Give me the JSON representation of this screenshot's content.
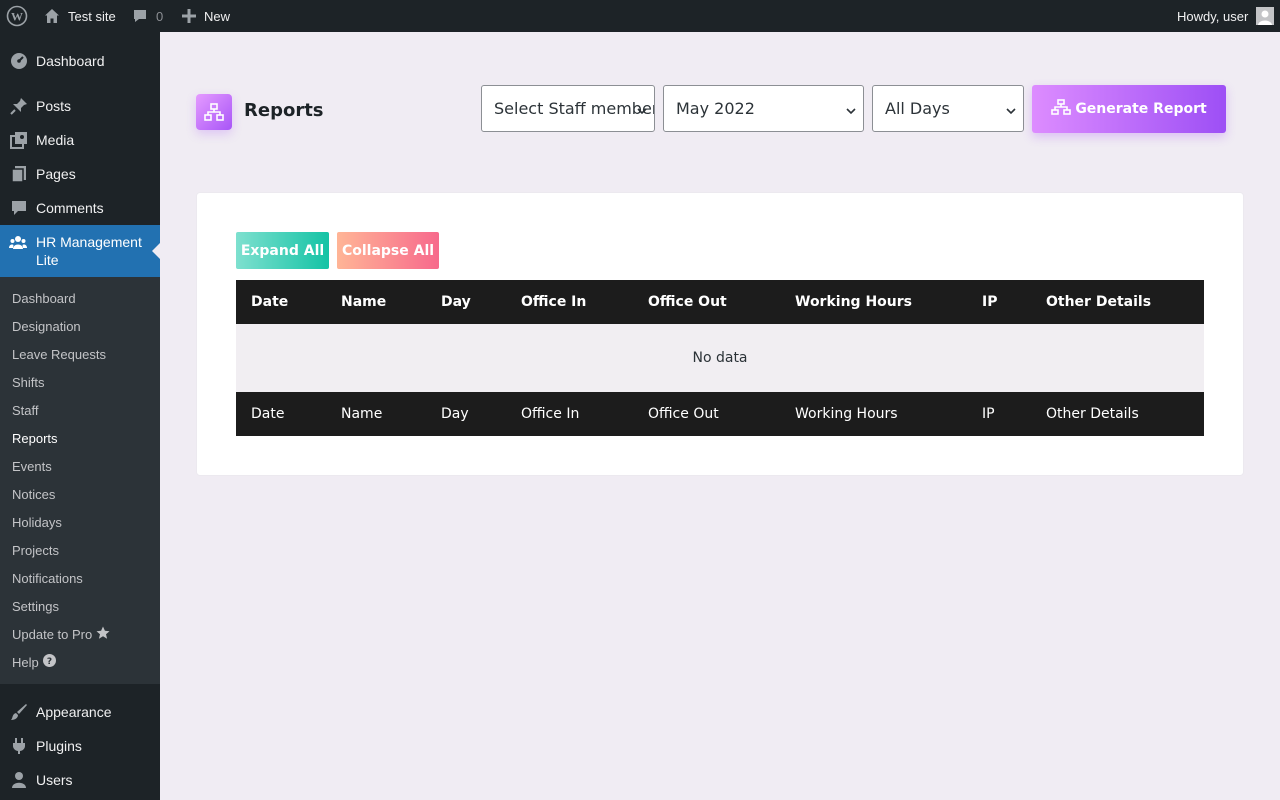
{
  "adminbar": {
    "site_name": "Test site",
    "comments_count": "0",
    "new_label": "New",
    "greeting": "Howdy, user"
  },
  "sidebar": {
    "items_top": [
      {
        "label": "Dashboard",
        "icon": "dashboard-icon"
      },
      {
        "label": "Posts",
        "icon": "pin-icon"
      },
      {
        "label": "Media",
        "icon": "media-icon"
      },
      {
        "label": "Pages",
        "icon": "pages-icon"
      },
      {
        "label": "Comments",
        "icon": "comment-icon"
      }
    ],
    "active": {
      "label_line1": "HR Management",
      "label_line2": "Lite",
      "icon": "users-group-icon"
    },
    "submenu": [
      "Dashboard",
      "Designation",
      "Leave Requests",
      "Shifts",
      "Staff",
      "Reports",
      "Events",
      "Notices",
      "Holidays",
      "Projects",
      "Notifications",
      "Settings",
      "Update to Pro",
      "Help"
    ],
    "submenu_current": "Reports",
    "items_bottom": [
      {
        "label": "Appearance",
        "icon": "brush-icon"
      },
      {
        "label": "Plugins",
        "icon": "plugin-icon"
      },
      {
        "label": "Users",
        "icon": "user-icon"
      }
    ]
  },
  "main": {
    "title": "Reports",
    "filters": {
      "staff": "Select Staff member",
      "month": "May 2022",
      "days": "All Days"
    },
    "generate_label": "Generate Report",
    "expand_label": "Expand All",
    "collapse_label": "Collapse All",
    "columns": [
      "Date",
      "Name",
      "Day",
      "Office In",
      "Office Out",
      "Working Hours",
      "IP",
      "Other Details"
    ],
    "empty_text": "No data"
  },
  "colors": {
    "accent_purple": "#a855f7",
    "wp_blue": "#2271b1",
    "expand_green": "#14c3a5",
    "collapse_pink": "#f7698c"
  }
}
